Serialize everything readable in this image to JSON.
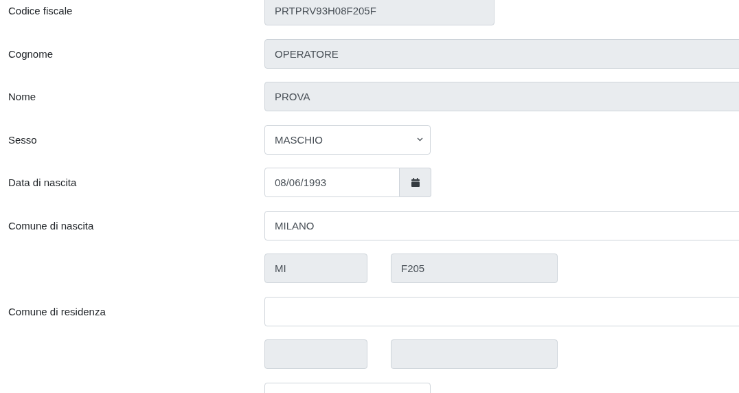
{
  "rows": [
    {
      "label": "Codice fiscale",
      "kind": "readonly",
      "value": "PRTPRV93H08F205F"
    },
    {
      "label": "Cognome",
      "kind": "readonly",
      "value": "OPERATORE"
    },
    {
      "label": "Nome",
      "kind": "readonly",
      "value": "PROVA"
    },
    {
      "label": "Sesso",
      "kind": "select",
      "value": "MASCHIO"
    },
    {
      "label": "Data di nascita",
      "kind": "date",
      "value": "08/06/1993"
    },
    {
      "label": "Comune di nascita",
      "kind": "text",
      "value": "MILANO"
    },
    {
      "kind": "pair",
      "fields": [
        {
          "kind": "readonly",
          "value": "MI"
        },
        {
          "kind": "readonly",
          "value": "F205"
        }
      ]
    },
    {
      "label": "Comune di residenza",
      "kind": "text"
    },
    {
      "kind": "pair",
      "fields": [
        {
          "kind": "readonly"
        },
        {
          "kind": "readonly"
        }
      ]
    },
    {
      "kind": "partial"
    }
  ]
}
